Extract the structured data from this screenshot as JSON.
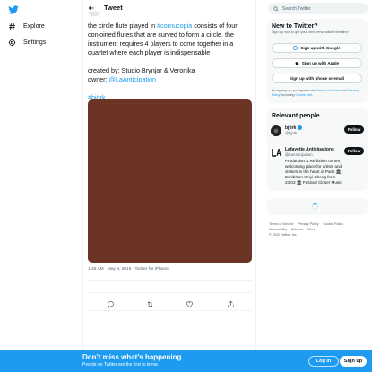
{
  "nav": {
    "items": [
      {
        "label": "Explore",
        "icon": "hash-icon"
      },
      {
        "label": "Settings",
        "icon": "gear-icon"
      }
    ]
  },
  "header": {
    "title": "Tweet"
  },
  "tweet": {
    "text_part1": "the circle flute played in ",
    "hashtag_cornucopia": "#cornucopia",
    "text_part2": " consists of four conjoined flutes that are curved to form a circle. the instrument requires 4 players to come together in a quartet where each player is indispensable",
    "credits_line": "created by: Studio Brynjar & Veronika",
    "owner_label": "owner: ",
    "owner_handle": "@LaAnticipation",
    "hashtag_bjork": "#björk",
    "media_color": "#6b3425",
    "timestamp": "1:25 AM · May 9, 2019 · Twitter for iPhone"
  },
  "search": {
    "placeholder": "Search Twitter"
  },
  "new_panel": {
    "title": "New to Twitter?",
    "subtitle": "Sign up now to get your own personalized timeline!",
    "google": "Sign up with Google",
    "apple": "Sign up with Apple",
    "phone": "Sign up with phone or email",
    "terms_1": "By signing up, you agree to the ",
    "terms_link": "Terms of Service",
    "terms_2": " and ",
    "privacy_link": "Privacy Policy",
    "terms_3": ", including ",
    "cookie_link": "Cookie Use",
    "terms_4": "."
  },
  "relevant": {
    "title": "Relevant people",
    "people": [
      {
        "name": "björk",
        "handle": "@bjork",
        "follow": "Follow",
        "bio": ""
      },
      {
        "name": "Lafayette Anticipations",
        "handle": "@LaAnticipation",
        "follow": "Follow",
        "bio": "Production & exhibition centre, welcoming place for artists and visitors in the heart of Paris 🏛 Exhibition Xinyi Cheng from 23.03 🏛 Festival Closer Music"
      }
    ]
  },
  "footer": {
    "links": [
      "Terms of Service",
      "Privacy Policy",
      "Cookie Policy",
      "Accessibility",
      "Ads info",
      "More ···"
    ],
    "copyright": "© 2022 Twitter, Inc."
  },
  "bottom_bar": {
    "title": "Don’t miss what’s happening",
    "subtitle": "People on Twitter are the first to know.",
    "login": "Log in",
    "signup": "Sign up"
  },
  "colors": {
    "accent": "#1d9bf0",
    "text": "#0f1419",
    "muted": "#536471"
  }
}
